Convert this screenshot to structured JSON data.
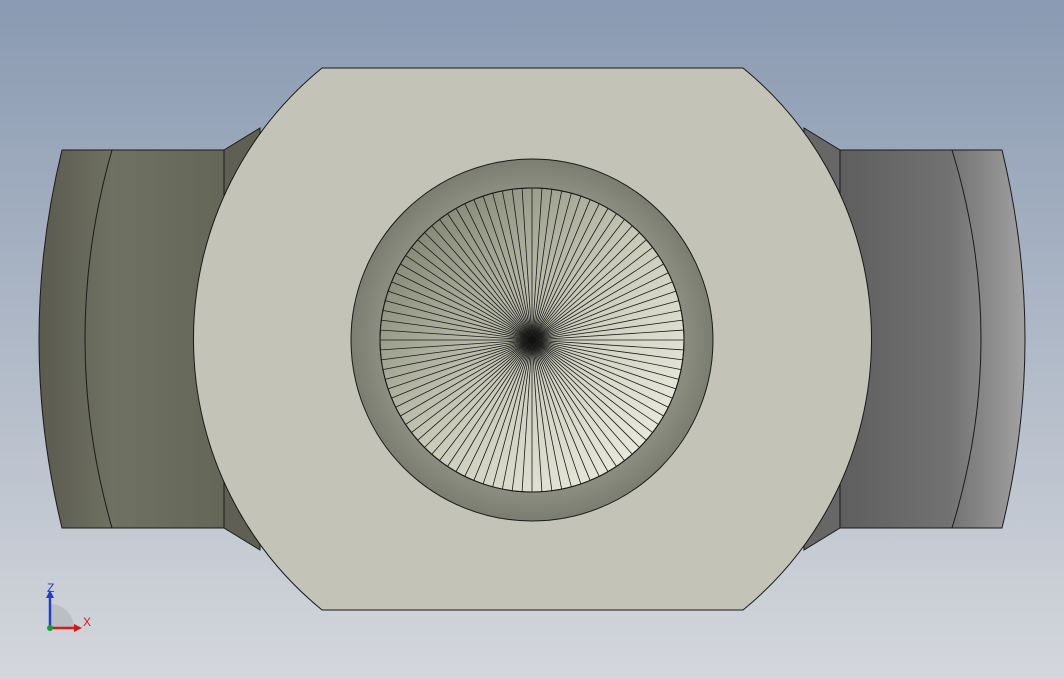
{
  "viewport": {
    "background_top": "#8a9ab2",
    "background_bottom": "#d4d7dc"
  },
  "model": {
    "face_color": "#c3c3b8",
    "side_left_dark": "#5d5e52",
    "side_left_light": "#737566",
    "side_right_dark": "#6a6a6a",
    "side_right_light": "#9a9a9a",
    "bore_ring_color": "#878a7c",
    "cone_light": "#f4f5e8",
    "cone_dark": "#6e715f",
    "edge_color": "#1a1a1a"
  },
  "triad": {
    "z_label": "Z",
    "x_label": "X",
    "z_color": "#1f3fc8",
    "x_color": "#d21a1a",
    "y_color": "#17a02a"
  }
}
